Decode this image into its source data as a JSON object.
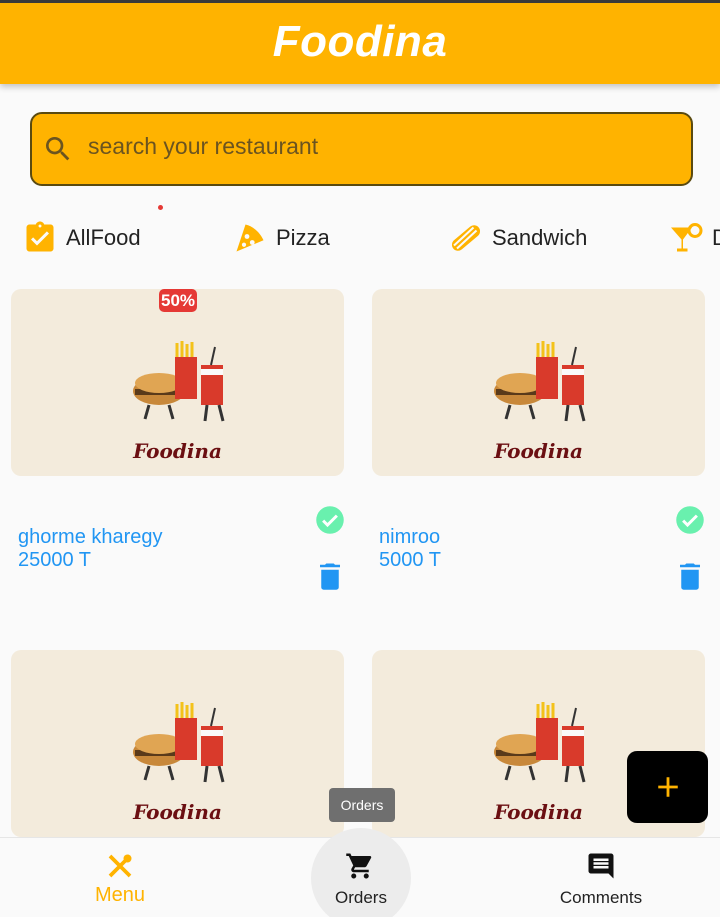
{
  "app": {
    "title": "Foodina"
  },
  "search": {
    "placeholder": "search your restaurant"
  },
  "categories": [
    {
      "label": "AllFood",
      "icon": "assignment-check-icon"
    },
    {
      "label": "Pizza",
      "icon": "pizza-icon"
    },
    {
      "label": "Sandwich",
      "icon": "hotdog-icon"
    },
    {
      "label": "D",
      "icon": "cocktail-icon"
    }
  ],
  "cards": [
    {
      "brand": "Foodina",
      "badge": "50%",
      "name": "ghorme kharegy",
      "price": "25000 T"
    },
    {
      "brand": "Foodina",
      "name": "nimroo",
      "price": "5000 T"
    },
    {
      "brand": "Foodina"
    },
    {
      "brand": "Foodina"
    }
  ],
  "tooltip": {
    "text": "Orders"
  },
  "fab": {
    "icon": "plus-icon"
  },
  "bottom_nav": [
    {
      "label": "Menu",
      "icon": "restaurant-icon",
      "active": true
    },
    {
      "label": "Orders",
      "icon": "cart-icon"
    },
    {
      "label": "Comments",
      "icon": "comment-icon"
    }
  ],
  "colors": {
    "primary": "#ffb300",
    "accent_blue": "#2196f3",
    "check_green": "#69f0ae",
    "badge_red": "#e53935"
  }
}
